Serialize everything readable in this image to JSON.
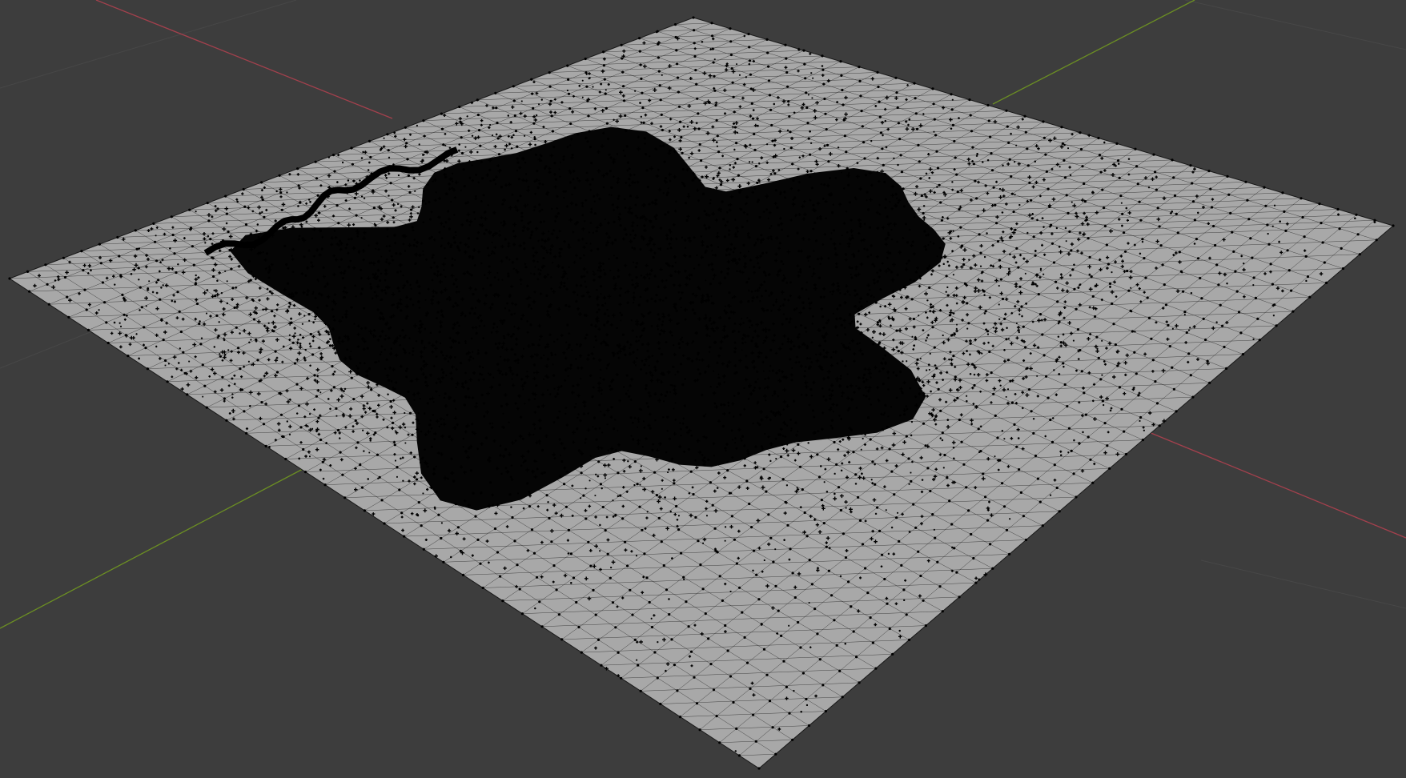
{
  "viewport": {
    "mode": "edit-mode-wireframe",
    "colors": {
      "background": "#3d3d3d",
      "floor_grid": "#474747",
      "x_axis": "#a4404d",
      "y_axis": "#6b8e23",
      "mesh_face": "#a8a8a8",
      "mesh_face_light": "#b4b4b4",
      "mesh_edge": "#1a1a1a",
      "vertex": "#000000"
    },
    "icons": {
      "mesh": "terrain-mesh-icon"
    }
  }
}
